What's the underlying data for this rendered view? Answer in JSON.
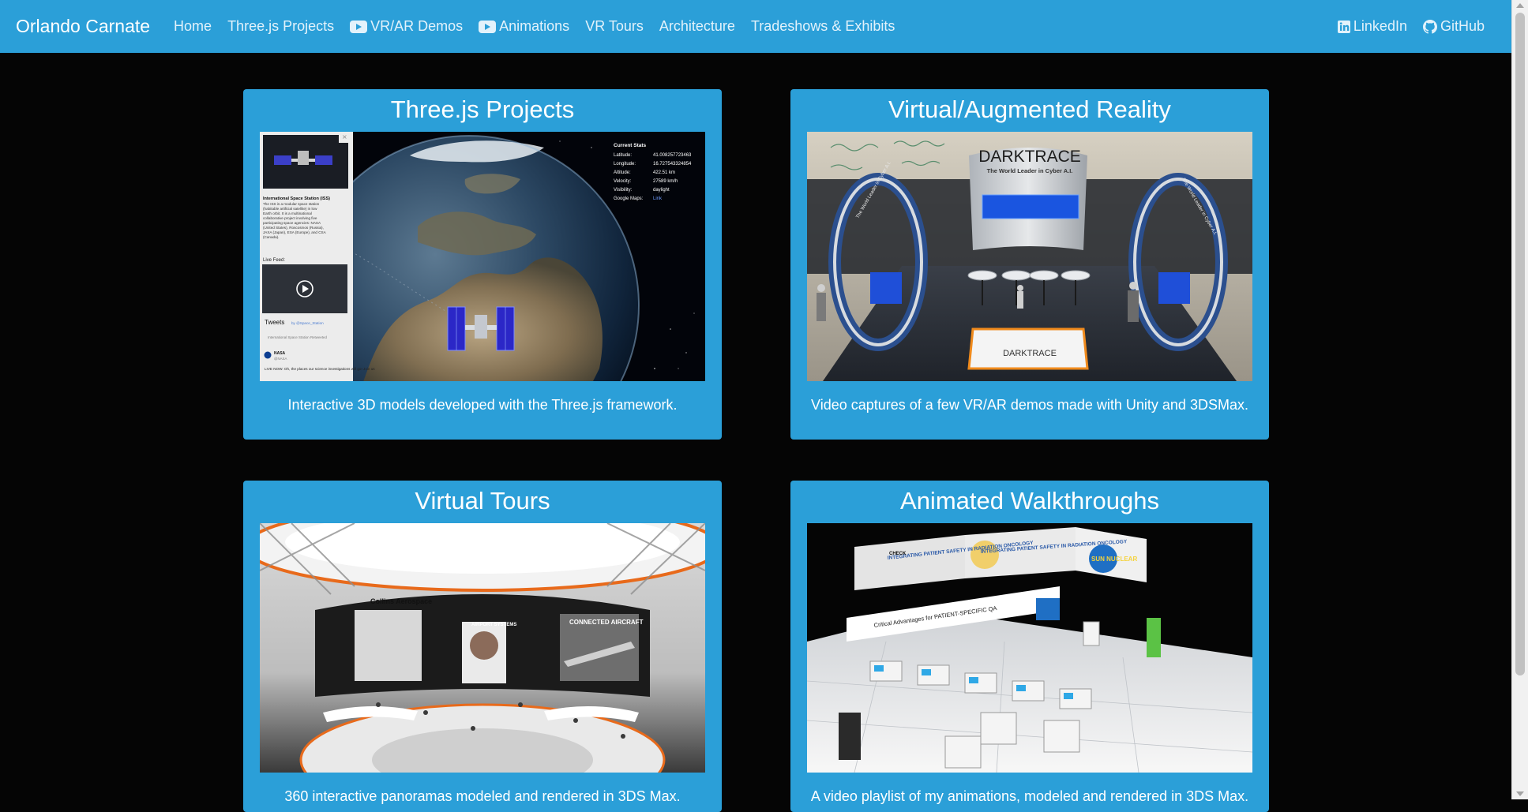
{
  "navbar": {
    "brand": "Orlando Carnate",
    "links": [
      {
        "label": "Home",
        "icon": ""
      },
      {
        "label": "Three.js Projects",
        "icon": ""
      },
      {
        "label": "VR/AR Demos",
        "icon": "youtube-icon"
      },
      {
        "label": "Animations",
        "icon": "youtube-icon"
      },
      {
        "label": "VR Tours",
        "icon": ""
      },
      {
        "label": "Architecture",
        "icon": ""
      },
      {
        "label": "Tradeshows & Exhibits",
        "icon": ""
      }
    ],
    "right_links": [
      {
        "label": "LinkedIn",
        "icon": "linkedin-icon"
      },
      {
        "label": "GitHub",
        "icon": "github-icon"
      }
    ],
    "color": "#2b9fd8"
  },
  "cards": [
    {
      "title": "Three.js Projects",
      "description": "Interactive 3D models developed with the Three.js framework.",
      "image": {
        "panel_heading": "International Space Station (ISS)",
        "panel_body": "The ISS is a modular space station (habitable artificial satellite) in low Earth orbit. It is a multinational collaborative project involving five participating space agencies: NASA (United States), Roscosmos (Russia), JAXA (Japan), ESA (Europe), and CSA (Canada).",
        "live_feed_label": "Live Feed:",
        "tweets_label": "Tweets",
        "tweets_by": "by @Space_Station",
        "retweet_label": "International Space Station Retweeted",
        "tweet_author": "NASA",
        "tweet_handle": "@NASA",
        "tweet_text": "LIVE NOW: Oh, the places our science investigations will go! Join us",
        "stats_title": "Current Stats",
        "stats": [
          {
            "label": "Latitude:",
            "value": "41.008257723463"
          },
          {
            "label": "Longitude:",
            "value": "16.727543324854"
          },
          {
            "label": "Altitude:",
            "value": "422.51 km"
          },
          {
            "label": "Velocity:",
            "value": "27589 km/h"
          },
          {
            "label": "Visibility:",
            "value": "daylight"
          },
          {
            "label": "Google Maps:",
            "value": "Link"
          }
        ]
      }
    },
    {
      "title": "Virtual/Augmented Reality",
      "description": "Video captures of a few VR/AR demos made with Unity and 3DSMax.",
      "image": {
        "brand_text": "DARKTRACE",
        "tagline": "The World Leader in Cyber A.I.",
        "counter_text": "DARKTRACE",
        "tower_text": "The World Leader in Cyber A.I."
      }
    },
    {
      "title": "Virtual Tours",
      "description": "360 interactive panoramas modeled and rendered in 3DS Max.",
      "image": {
        "brand_text": "Collins Aerospace",
        "panel_left": "AIRPORT SYSTEMS",
        "panel_right": "CONNECTED AIRCRAFT"
      }
    },
    {
      "title": "Animated Walkthroughs",
      "description": "A video playlist of my animations, modeled and rendered in 3DS Max.",
      "image": {
        "banner_text_1": "INTEGRATING PATIENT SAFETY IN RADIATION ONCOLOGY",
        "banner_text_2": "INTEGRATING PATIENT SAFETY IN RADIATION ONCOLOGY",
        "brand_text": "SUN NUCLEAR",
        "wall_text": "Critical Advantages for PATIENT-SPECIFIC QA",
        "check_label": "CHECK"
      }
    }
  ]
}
